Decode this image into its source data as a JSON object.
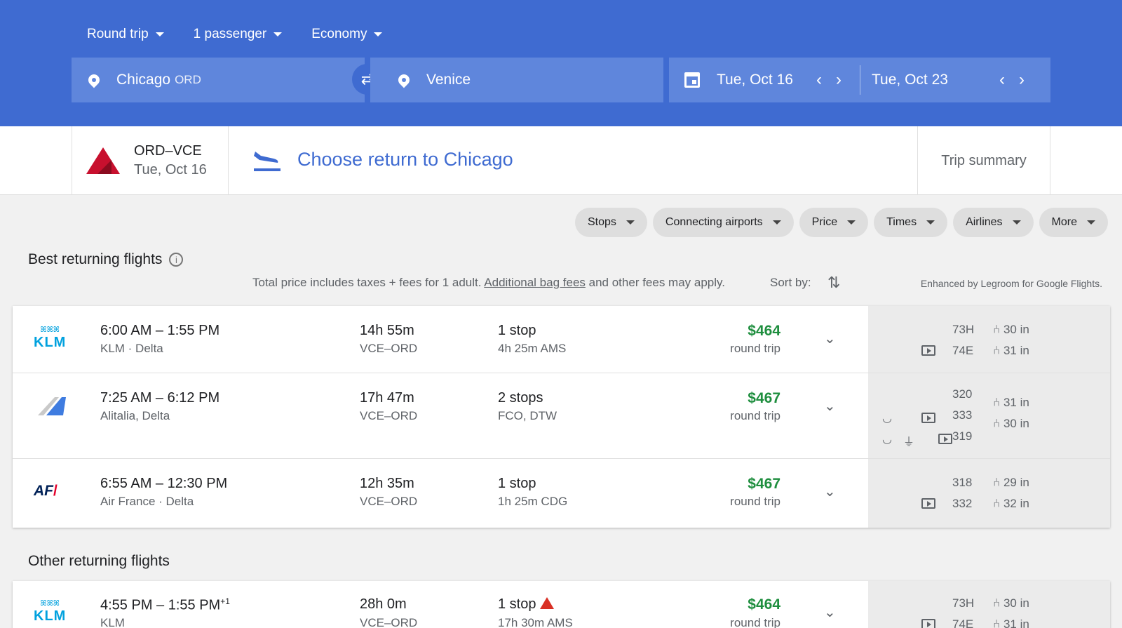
{
  "header": {
    "trip_type": "Round trip",
    "passengers": "1 passenger",
    "cabin": "Economy",
    "origin": "Chicago",
    "origin_code": "ORD",
    "destination": "Venice",
    "depart_date": "Tue, Oct 16",
    "return_date": "Tue, Oct 23"
  },
  "steps": {
    "leg1_route": "ORD–VCE",
    "leg1_date": "Tue, Oct 16",
    "current": "Choose return to Chicago",
    "summary": "Trip summary"
  },
  "filters": [
    "Stops",
    "Connecting airports",
    "Price",
    "Times",
    "Airlines",
    "More"
  ],
  "best": {
    "title": "Best returning flights",
    "note_before": "Total price includes taxes + fees for 1 adult.",
    "note_link": "Additional bag fees",
    "note_after": "and other fees may apply.",
    "sort_label": "Sort by:",
    "enhanced": "Enhanced by Legroom for Google Flights."
  },
  "flights": [
    {
      "times": "6:00 AM – 1:55 PM",
      "carrier": "KLM · Delta",
      "duration": "14h 55m",
      "route": "VCE–ORD",
      "stops": "1 stop",
      "stop_detail": "4h 25m AMS",
      "price": "$464",
      "price_note": "round trip",
      "aircraft": [
        "73H",
        "74E"
      ],
      "legroom": [
        "30 in",
        "31 in"
      ]
    },
    {
      "times": "7:25 AM – 6:12 PM",
      "carrier": "Alitalia, Delta",
      "duration": "17h 47m",
      "route": "VCE–ORD",
      "stops": "2 stops",
      "stop_detail": "FCO, DTW",
      "price": "$467",
      "price_note": "round trip",
      "aircraft": [
        "320",
        "333",
        "319"
      ],
      "legroom": [
        "31 in",
        "30 in"
      ]
    },
    {
      "times": "6:55 AM – 12:30 PM",
      "carrier": "Air France · Delta",
      "duration": "12h 35m",
      "route": "VCE–ORD",
      "stops": "1 stop",
      "stop_detail": "1h 25m CDG",
      "price": "$467",
      "price_note": "round trip",
      "aircraft": [
        "318",
        "332"
      ],
      "legroom": [
        "29 in",
        "32 in"
      ]
    }
  ],
  "other": {
    "title": "Other returning flights",
    "flight": {
      "times": "4:55 PM – 1:55 PM",
      "plus_day": "+1",
      "carrier": "KLM",
      "duration": "28h 0m",
      "route": "VCE–ORD",
      "stops": "1 stop",
      "stop_detail": "17h 30m AMS",
      "price": "$464",
      "price_note": "round trip",
      "aircraft": [
        "73H",
        "74E"
      ],
      "legroom": [
        "30 in",
        "31 in"
      ]
    }
  },
  "logos": {
    "klm": "KLM",
    "airfrance": "AF"
  },
  "colors": {
    "header": "#3f6bd1",
    "price": "#1e8e3e",
    "link": "#3f6bd1",
    "delta": "#c8102e"
  }
}
